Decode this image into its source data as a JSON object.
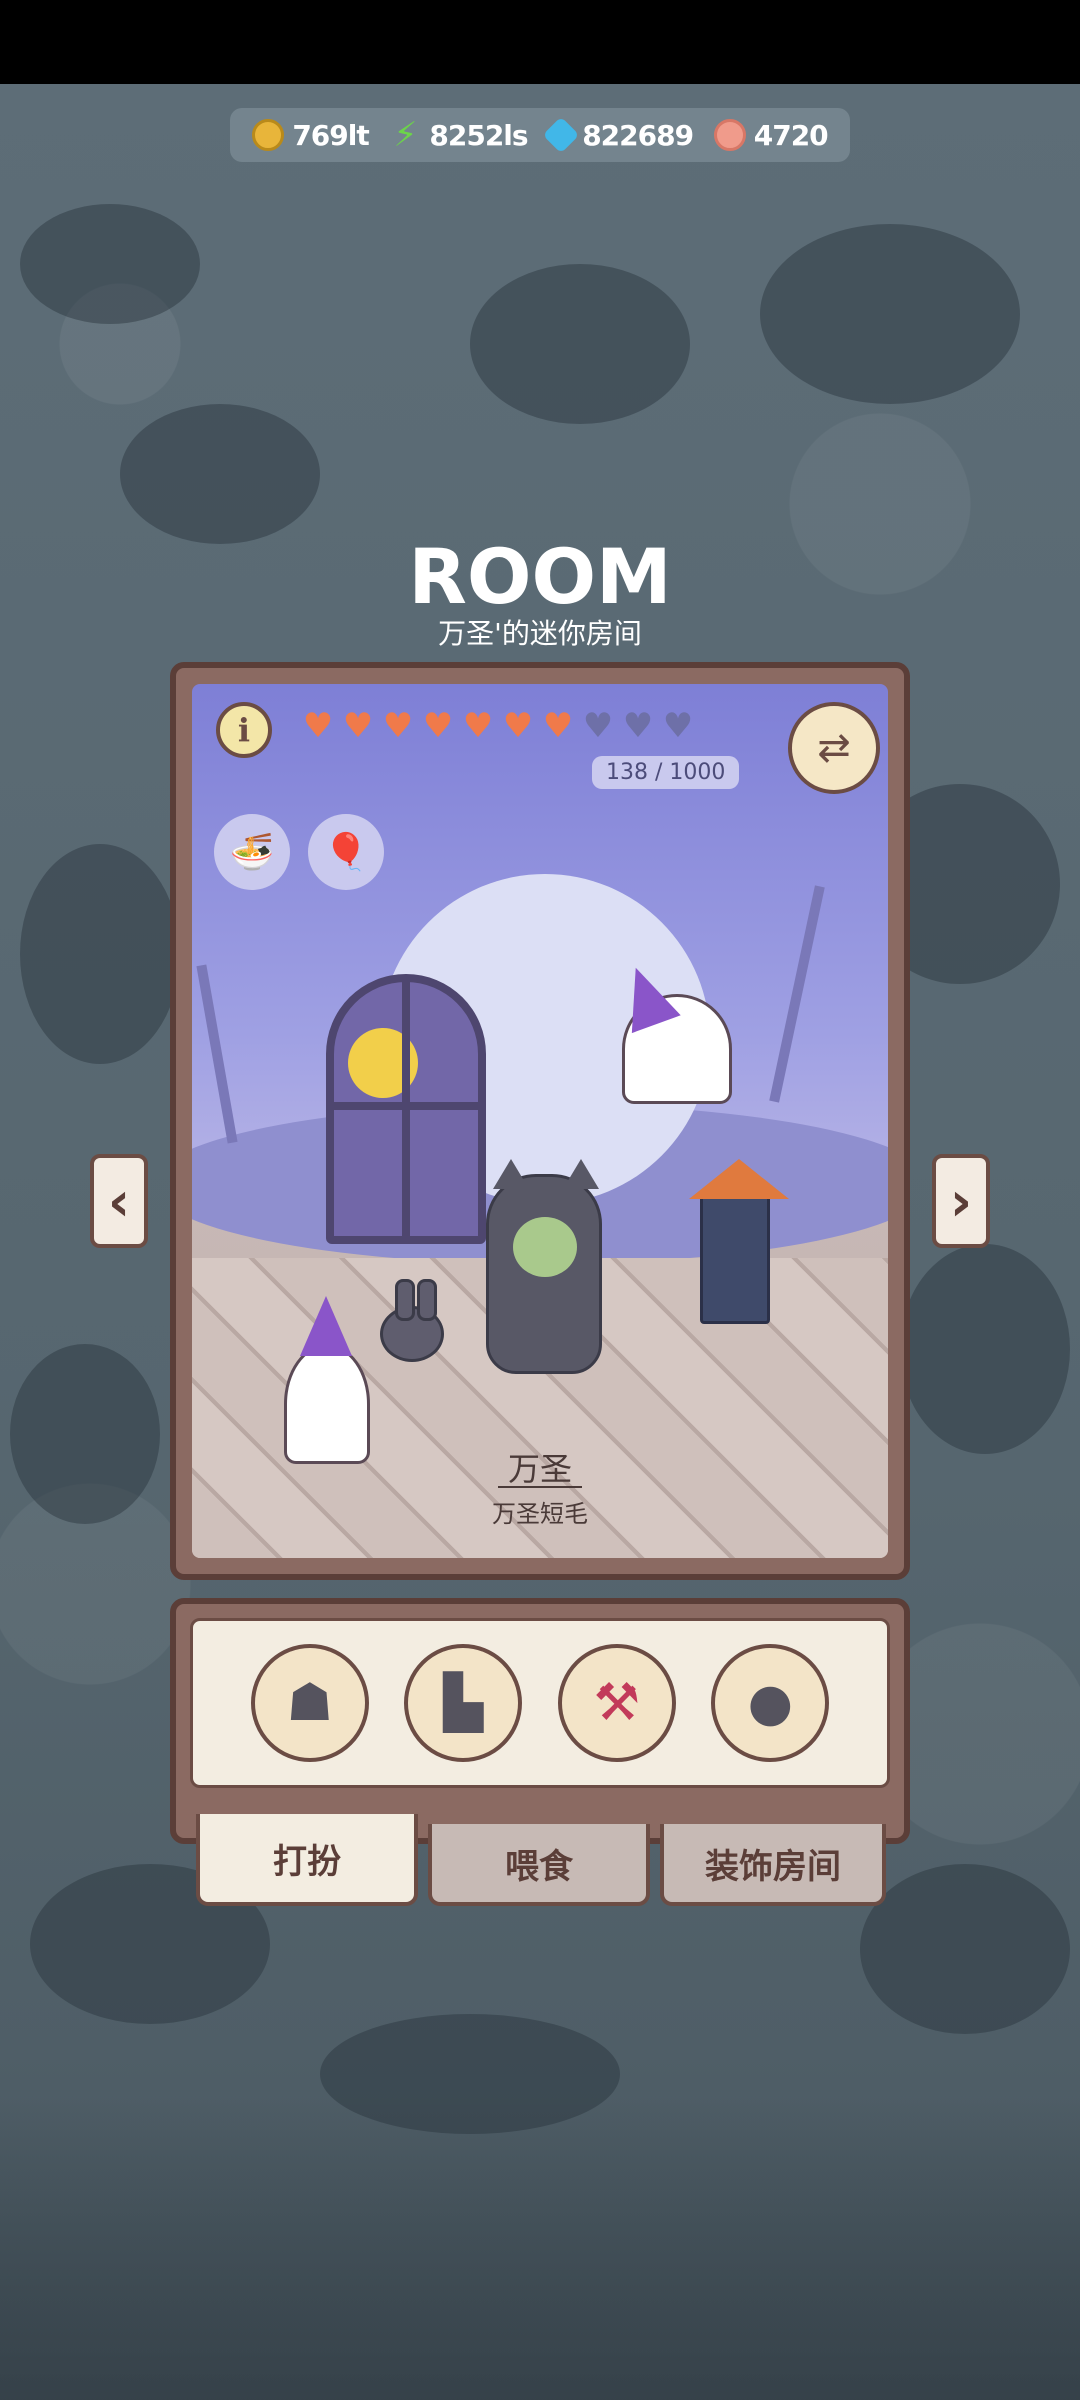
{
  "currency": {
    "coins": "769lt",
    "energy": "8252ls",
    "gems": "822689",
    "paws": "4720"
  },
  "title": "ROOM",
  "subtitle": "万圣'的迷你房间",
  "room": {
    "hearts_full": 7,
    "hearts_total": 10,
    "hp_text": "138 / 1000",
    "info_icon": "i",
    "pet_name": "万圣",
    "pet_breed": "万圣短毛"
  },
  "nav": {
    "prev": "‹",
    "next": "›"
  },
  "items": [
    {
      "name": "ghost-hood-icon"
    },
    {
      "name": "cape-icon"
    },
    {
      "name": "scythe-icon"
    },
    {
      "name": "bunny-plush-icon"
    }
  ],
  "tabs": {
    "dress": "打扮",
    "feed": "喂食",
    "decorate": "装饰房间"
  },
  "colors": {
    "heart_full": "#f07a4a",
    "heart_empty": "#6e70a8",
    "frame": "#8b6a62",
    "panel_bg": "#f3ede1"
  }
}
